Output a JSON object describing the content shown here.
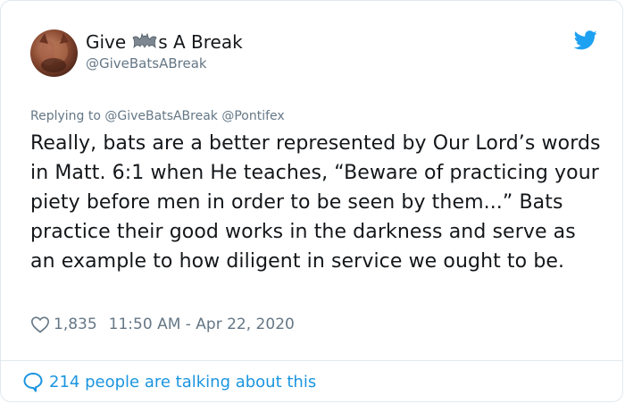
{
  "author": {
    "name_prefix": "Give",
    "name_suffix": "s A Break",
    "name_emoji_icon": "bat-icon",
    "handle": "@GiveBatsABreak"
  },
  "reply": {
    "text": "Replying to @GiveBatsABreak @Pontifex"
  },
  "tweet": {
    "text": "Really, bats are a better represented by Our Lord’s words in Matt. 6:1 when He teaches, “Beware of practicing your piety before men in order to be seen by them...” Bats practice their good works in the darkness and serve as an example to how diligent in service we ought to be."
  },
  "stats": {
    "likes": "1,835",
    "timestamp": "11:50 AM - Apr 22, 2020"
  },
  "footer": {
    "talking_text": "214 people are talking about this"
  },
  "icons": {
    "heart": "heart-icon",
    "twitter": "twitter-bird-icon",
    "comment": "comment-bubble-icon"
  },
  "colors": {
    "accent": "#1b95e0",
    "muted": "#657786",
    "twitter_blue": "#1da1f2"
  }
}
